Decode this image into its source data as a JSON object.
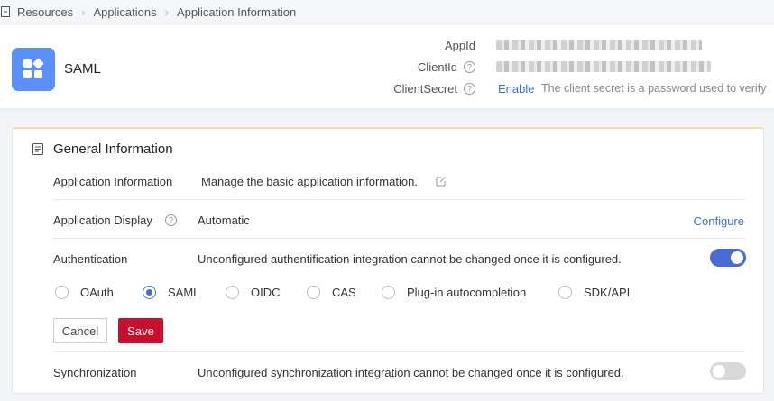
{
  "breadcrumb": {
    "items": [
      "Resources",
      "Applications",
      "Application Information"
    ]
  },
  "header": {
    "app_name": "SAML",
    "appid_label": "AppId",
    "clientid_label": "ClientId",
    "clientsecret_label": "ClientSecret",
    "enable_link": "Enable",
    "secret_hint": "The client secret is a password used to verify"
  },
  "card": {
    "title": "General Information",
    "rows": {
      "app_info": {
        "label": "Application Information",
        "value": "Manage the basic application information."
      },
      "app_display": {
        "label": "Application Display",
        "value": "Automatic",
        "action": "Configure"
      },
      "authentication": {
        "label": "Authentication",
        "value": "Unconfigured authentification integration cannot be changed once it is configured.",
        "enabled": true
      },
      "synchronization": {
        "label": "Synchronization",
        "value": "Unconfigured synchronization integration cannot be changed once it is configured.",
        "enabled": false
      }
    },
    "protocols": [
      "OAuth",
      "SAML",
      "OIDC",
      "CAS",
      "Plug-in autocompletion",
      "SDK/API"
    ],
    "selected_protocol": "SAML",
    "cancel_label": "Cancel",
    "save_label": "Save"
  },
  "colors": {
    "accent": "#4a6bd6",
    "link": "#3a6fd8",
    "save": "#c8102e",
    "logo": "#5b8ff9"
  },
  "icons": [
    "collapse-icon",
    "chevron-right-icon",
    "app-grid-icon",
    "help-icon",
    "document-icon",
    "edit-icon"
  ]
}
